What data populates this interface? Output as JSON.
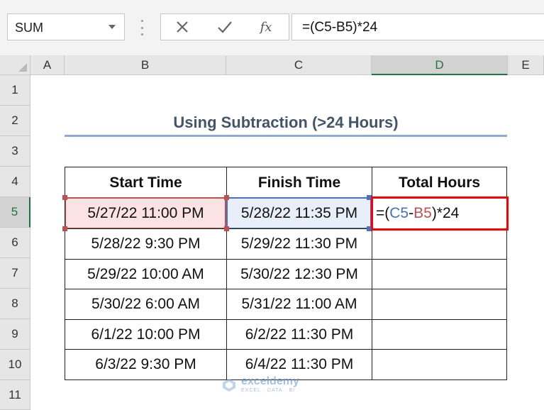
{
  "formula_bar": {
    "name_box": "SUM",
    "cancel_icon": "close-icon",
    "enter_icon": "checkmark-icon",
    "function_icon": "fx",
    "formula": "=(C5-B5)*24"
  },
  "columns": [
    "A",
    "B",
    "C",
    "D",
    "E"
  ],
  "selected_column": "D",
  "rows": [
    "1",
    "2",
    "3",
    "4",
    "5",
    "6",
    "7",
    "8",
    "9",
    "10",
    "11"
  ],
  "selected_row": "5",
  "sheet": {
    "title": "Using Subtraction (>24 Hours)",
    "headers": [
      "Start Time",
      "Finish Time",
      "Total Hours"
    ],
    "data": [
      [
        "5/27/22 11:00 PM",
        "5/28/22 11:35 PM"
      ],
      [
        "5/28/22 9:30 PM",
        "5/29/22 11:30 PM"
      ],
      [
        "5/29/22 10:00 AM",
        "5/30/22 12:30 PM"
      ],
      [
        "5/30/22 6:00 AM",
        "5/31/22 11:00 AM"
      ],
      [
        "6/1/22 10:00 PM",
        "6/2/22 11:30 PM"
      ],
      [
        "6/3/22 9:30 PM",
        "6/4/22 11:30 PM"
      ]
    ],
    "editing_cell": {
      "prefix": "=(",
      "ref1": "C5",
      "minus": "-",
      "ref2": "B5",
      "suffix": ")*24"
    }
  },
  "colors": {
    "ref_c": "#4472c4",
    "ref_b": "#c0504d",
    "edit_border": "#ff0000",
    "title": "#44546a",
    "excel_green": "#217346"
  },
  "watermark": {
    "name": "exceldemy",
    "tagline": "EXCEL · DATA · BI"
  }
}
